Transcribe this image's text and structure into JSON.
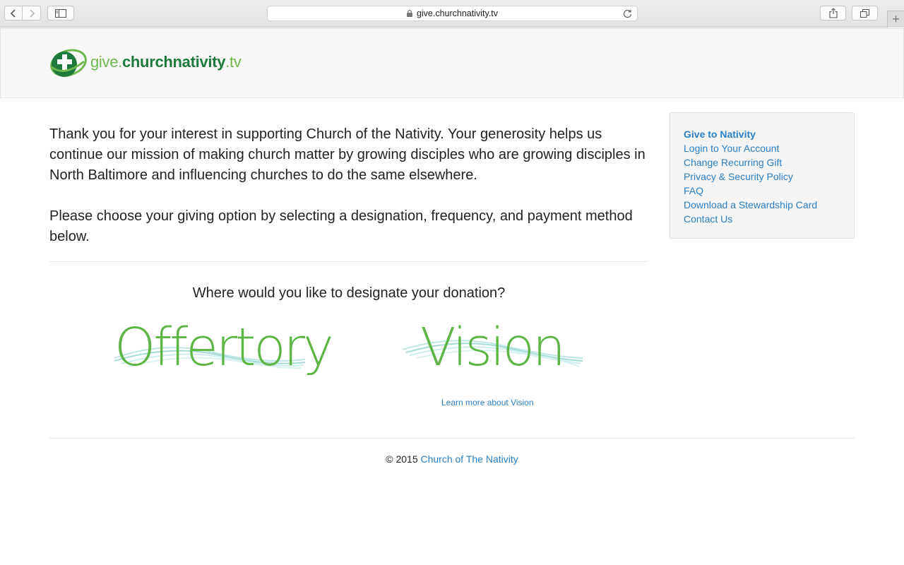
{
  "browser": {
    "url": "give.churchnativity.tv",
    "icons": [
      "back-icon",
      "forward-icon",
      "sidebar-icon",
      "lock-icon",
      "reload-icon",
      "share-icon",
      "tabs-icon",
      "plus-icon"
    ],
    "newtab_symbol": "+"
  },
  "header": {
    "logo_give": "give.",
    "logo_main": "churchnativity",
    "logo_tv": ".tv",
    "brand_colors": {
      "dark_green": "#1d7a3c",
      "light_green": "#6fb74f"
    }
  },
  "main": {
    "intro_1": "Thank you for your interest in supporting Church of the Nativity. Your generosity helps us continue our mission of making church matter by growing disciples who are growing disciples in North Baltimore and influencing churches to do the same elsewhere.",
    "intro_2": "Please choose your giving option by selecting a designation, frequency, and payment method below.",
    "question": "Where would you like to designate your donation?",
    "options": [
      {
        "label": "Offertory"
      },
      {
        "label": "Vision"
      }
    ],
    "learn_more": "Learn more about Vision",
    "accent_color": "#5cb544"
  },
  "sidebar": {
    "items": [
      {
        "label": "Give to Nativity",
        "active": true
      },
      {
        "label": "Login to Your Account"
      },
      {
        "label": "Change Recurring Gift"
      },
      {
        "label": "Privacy & Security Policy"
      },
      {
        "label": "FAQ"
      },
      {
        "label": "Download a Stewardship Card"
      },
      {
        "label": "Contact Us"
      }
    ],
    "link_color": "#2a7fc4"
  },
  "footer": {
    "copyright": "© 2015",
    "org_link": "Church of The Nativity"
  }
}
